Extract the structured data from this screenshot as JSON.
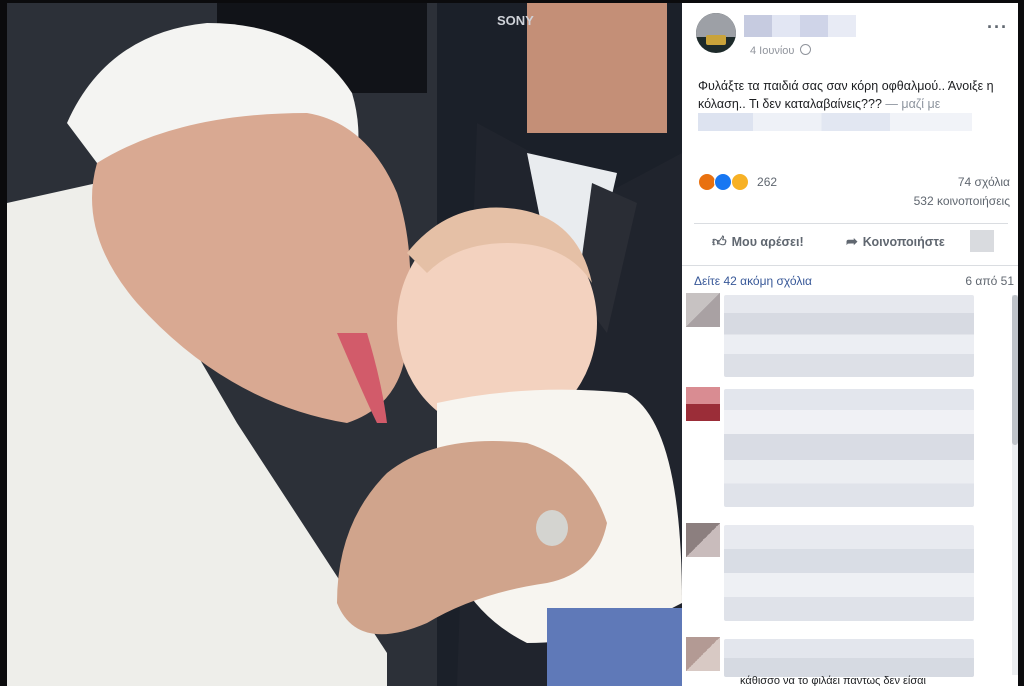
{
  "photo": {
    "camera_brand": "SONY"
  },
  "post": {
    "date": "4 Ιουνίου",
    "text": "Φυλάξτε τα παιδιά σας σαν κόρη οφθαλμού.. Άνοιξε η κόλαση.. Τι δεν καταλαβαίνεις???",
    "with_label": "— μαζί με",
    "reaction_count": "262",
    "comments_count": "74 σχόλια",
    "shares_count": "532 κοινοποιήσεις"
  },
  "actions": {
    "like_label": "Μου αρέσει!",
    "share_label": "Κοινοποιήστε"
  },
  "comments": {
    "view_more_label": "Δείτε 42 ακόμη σχόλια",
    "paging": "6 από 51",
    "cutoff_text": "κάθισσο να το φιλάει παντως δεν είσαι"
  },
  "colors": {
    "accent": "#385898",
    "like": "#1877f2",
    "angry": "#e9710f",
    "wow": "#f7b125"
  },
  "icons": [
    "globe-icon",
    "more-options-icon",
    "thumbs-up-icon",
    "share-arrow-icon"
  ]
}
